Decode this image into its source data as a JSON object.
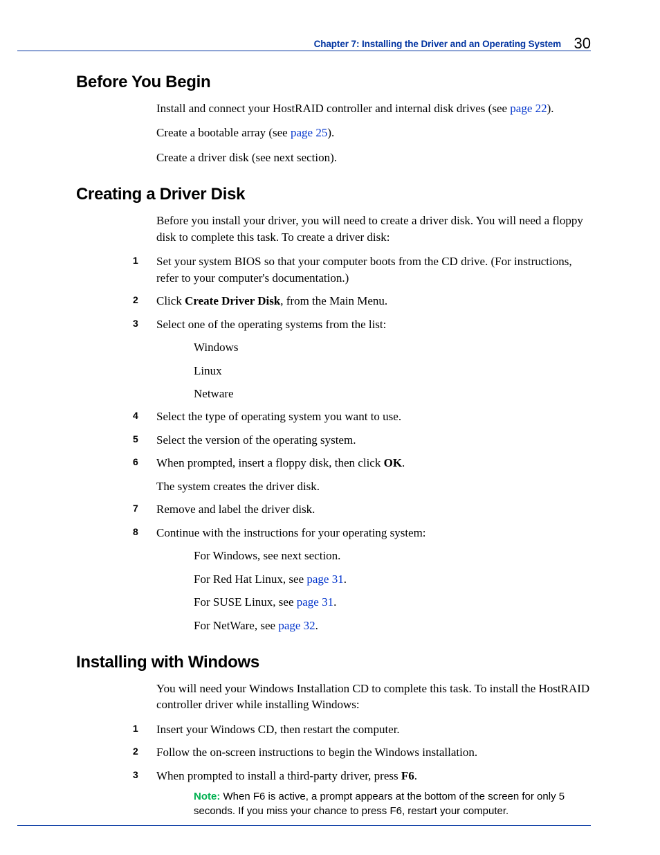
{
  "header": {
    "chapter": "Chapter 7: Installing the Driver and an Operating System",
    "page_number": "30"
  },
  "sections": {
    "before": {
      "title": "Before You Begin",
      "p1a": "Install and connect your HostRAID controller and internal disk drives (see ",
      "p1link": "page 22",
      "p1b": ").",
      "p2a": "Create a bootable array (see ",
      "p2link": "page 25",
      "p2b": ").",
      "p3": "Create a driver disk (see next section)."
    },
    "creating": {
      "title": "Creating a Driver Disk",
      "intro": "Before you install your driver, you will need to create a driver disk. You will need a floppy disk to complete this task. To create a driver disk:",
      "s1": "Set your system BIOS so that your computer boots from the CD drive. (For instructions, refer to your computer's documentation.)",
      "s2a": "Click ",
      "s2bold": "Create Driver Disk",
      "s2b": ", from the Main Menu.",
      "s3": "Select one of the operating systems from the list:",
      "s3_windows": "Windows",
      "s3_linux": "Linux",
      "s3_netware": "Netware",
      "s4": "Select the type of operating system you want to use.",
      "s5": "Select the version of the operating system.",
      "s6a": "When prompted, insert a floppy disk, then click ",
      "s6bold": "OK",
      "s6b": ".",
      "s6_after": "The system creates the driver disk.",
      "s7": "Remove and label the driver disk.",
      "s8": "Continue with the instructions for your operating system:",
      "s8_win": "For Windows, see next section.",
      "s8_rh_a": "For Red Hat Linux, see ",
      "s8_rh_link": "page 31",
      "s8_rh_b": ".",
      "s8_suse_a": "For SUSE Linux, see ",
      "s8_suse_link": "page 31",
      "s8_suse_b": ".",
      "s8_nw_a": "For NetWare, see ",
      "s8_nw_link": "page 32",
      "s8_nw_b": "."
    },
    "installing": {
      "title": "Installing with Windows",
      "intro": "You will need your Windows Installation CD to complete this task. To install the HostRAID controller driver while installing Windows:",
      "s1": "Insert your Windows CD, then restart the computer.",
      "s2": "Follow the on-screen instructions to begin the Windows installation.",
      "s3a": "When prompted to install a third-party driver, press ",
      "s3bold": "F6",
      "s3b": ".",
      "note_label": "Note:",
      "note_body": " When F6 is active, a prompt appears at the bottom of the screen for only 5 seconds. If you miss your chance to press F6, restart your computer."
    }
  }
}
